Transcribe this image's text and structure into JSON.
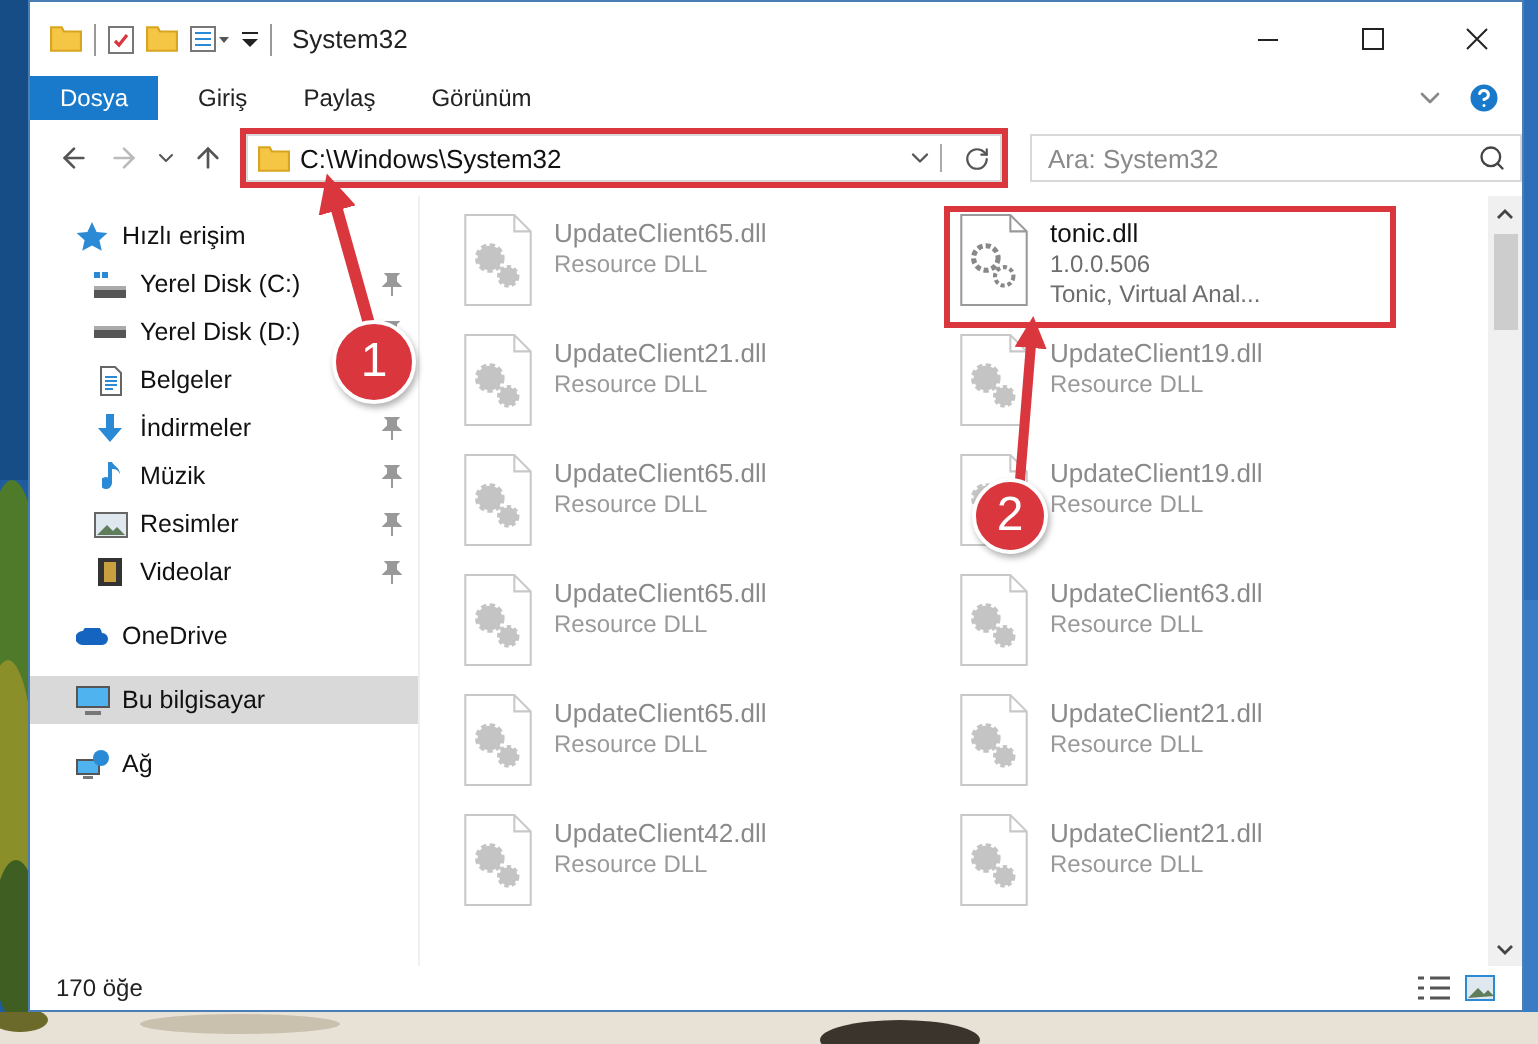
{
  "window": {
    "title": "System32"
  },
  "ribbon": {
    "tabs": [
      {
        "label": "Dosya",
        "selected": true
      },
      {
        "label": "Giriş",
        "selected": false
      },
      {
        "label": "Paylaş",
        "selected": false
      },
      {
        "label": "Görünüm",
        "selected": false
      }
    ]
  },
  "address": {
    "path": "C:\\Windows\\System32",
    "framed": true
  },
  "search": {
    "placeholder": "Ara: System32"
  },
  "sidebar": {
    "items": [
      {
        "label": "Hızlı erişim",
        "kind": "star",
        "selected": false,
        "pinned": false,
        "children": [
          {
            "label": "Yerel Disk (C:)",
            "kind": "system-drive",
            "selected": false,
            "pinned": true
          },
          {
            "label": "Yerel Disk (D:)",
            "kind": "drive",
            "selected": false,
            "pinned": true
          },
          {
            "label": "Belgeler",
            "kind": "documents",
            "selected": false
          },
          {
            "label": "İndirmeler",
            "kind": "download",
            "selected": false,
            "pinned": true
          },
          {
            "label": "Müzik",
            "kind": "music",
            "selected": false,
            "pinned": true
          },
          {
            "label": "Resimler",
            "kind": "pictures",
            "selected": false,
            "pinned": true
          },
          {
            "label": "Videolar",
            "kind": "videos",
            "selected": false,
            "pinned": true
          }
        ]
      },
      {
        "label": "OneDrive",
        "kind": "cloud",
        "selected": false,
        "pinned": false
      },
      {
        "label": "Bu bilgisayar",
        "kind": "computer",
        "selected": true,
        "pinned": false
      },
      {
        "label": "Ağ",
        "kind": "network",
        "selected": false,
        "pinned": false
      }
    ]
  },
  "files": [
    {
      "name": "UpdateClient65.dll",
      "details": [
        "Resource DLL"
      ],
      "blurred": true,
      "framed": false
    },
    {
      "name": "tonic.dll",
      "details": [
        "1.0.0.506",
        "Tonic, Virtual Anal..."
      ],
      "blurred": false,
      "framed": true
    },
    {
      "name": "UpdateClient21.dll",
      "details": [
        "Resource DLL"
      ],
      "blurred": true,
      "framed": false
    },
    {
      "name": "UpdateClient19.dll",
      "details": [
        "Resource DLL"
      ],
      "blurred": true,
      "framed": false
    },
    {
      "name": "UpdateClient65.dll",
      "details": [
        "Resource DLL"
      ],
      "blurred": true,
      "framed": false
    },
    {
      "name": "UpdateClient19.dll",
      "details": [
        "Resource DLL"
      ],
      "blurred": true,
      "framed": false
    },
    {
      "name": "UpdateClient65.dll",
      "details": [
        "Resource DLL"
      ],
      "blurred": true,
      "framed": false
    },
    {
      "name": "UpdateClient63.dll",
      "details": [
        "Resource DLL"
      ],
      "blurred": true,
      "framed": false
    },
    {
      "name": "UpdateClient65.dll",
      "details": [
        "Resource DLL"
      ],
      "blurred": true,
      "framed": false
    },
    {
      "name": "UpdateClient21.dll",
      "details": [
        "Resource DLL"
      ],
      "blurred": true,
      "framed": false
    },
    {
      "name": "UpdateClient42.dll",
      "details": [
        "Resource DLL"
      ],
      "blurred": true,
      "framed": false
    },
    {
      "name": "UpdateClient21.dll",
      "details": [
        "Resource DLL"
      ],
      "blurred": true,
      "framed": false
    }
  ],
  "status_bar": {
    "count": "170 öğe"
  },
  "annotations": [
    {
      "number": "1"
    },
    {
      "number": "2"
    }
  ]
}
